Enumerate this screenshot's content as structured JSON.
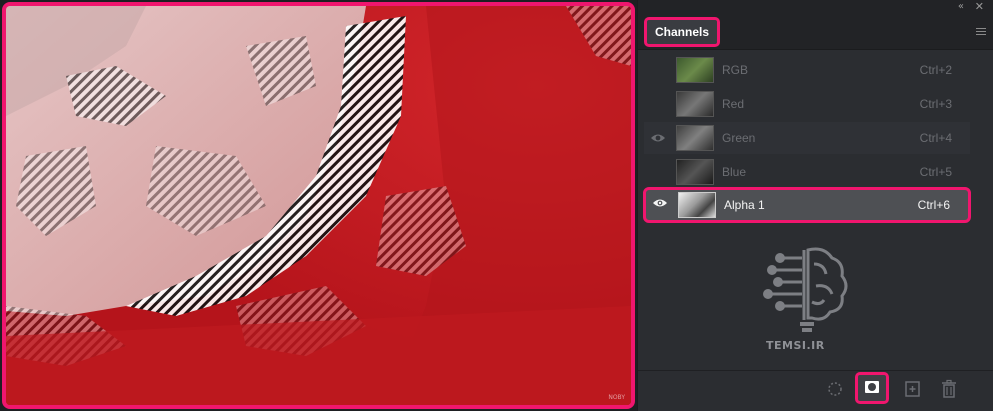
{
  "window": {
    "collapse_glyph": "«",
    "close_glyph": "✕"
  },
  "panel": {
    "tab_label": "Channels",
    "channels": [
      {
        "name": "RGB",
        "shortcut": "Ctrl+2",
        "visible": false,
        "selected": false
      },
      {
        "name": "Red",
        "shortcut": "Ctrl+3",
        "visible": false,
        "selected": false
      },
      {
        "name": "Green",
        "shortcut": "Ctrl+4",
        "visible": true,
        "selected": false
      },
      {
        "name": "Blue",
        "shortcut": "Ctrl+5",
        "visible": false,
        "selected": false
      },
      {
        "name": "Alpha 1",
        "shortcut": "Ctrl+6",
        "visible": true,
        "selected": true
      }
    ]
  },
  "watermark": {
    "text": "TEMSI.IR",
    "canvas_corner": "NOBY"
  },
  "colors": {
    "highlight": "#f0166e",
    "overlay_red": "#c81c22",
    "panel_bg": "#2b2d31"
  },
  "icons": {
    "eye": "eye-icon",
    "selection": "dotted-selection-icon",
    "mask": "save-selection-as-channel-icon",
    "new_channel": "new-channel-icon",
    "delete": "trash-icon"
  }
}
